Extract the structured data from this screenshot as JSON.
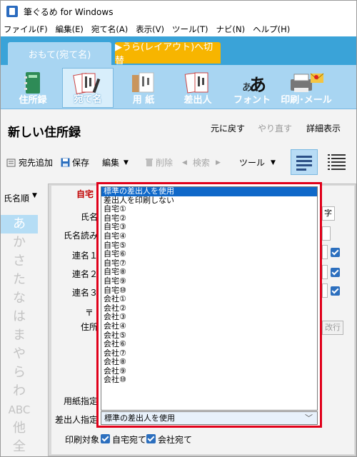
{
  "window": {
    "title": "筆ぐるめ for Windows"
  },
  "menu": [
    "ファイル(F)",
    "編集(E)",
    "宛て名(A)",
    "表示(V)",
    "ツール(T)",
    "ナビ(N)",
    "ヘルプ(H)"
  ],
  "tabs": {
    "front": "おもて(宛て名)",
    "back": "▶うら(レイアウト)へ切替"
  },
  "ribbon": [
    {
      "label": "住所録",
      "icon": "address-book-icon"
    },
    {
      "label": "宛て名",
      "icon": "postcards-icon",
      "selected": true
    },
    {
      "label": "用 紙",
      "icon": "envelope-paper-icon"
    },
    {
      "label": "差出人",
      "icon": "sender-postcard-icon"
    },
    {
      "label": "フォント",
      "icon": "font-icon"
    },
    {
      "label": "印刷･メール",
      "icon": "printer-mail-icon"
    }
  ],
  "header": {
    "title": "新しい住所録",
    "undo": "元に戻す",
    "redo": "やり直す",
    "detail": "詳細表示"
  },
  "toolbar": {
    "add": "宛先追加",
    "save": "保存",
    "edit": "編集",
    "delete": "削除",
    "search": "検索",
    "tool": "ツール"
  },
  "sidebar": {
    "sort_label": "氏名順",
    "kana": [
      "あ",
      "か",
      "さ",
      "た",
      "な",
      "は",
      "ま",
      "や",
      "ら",
      "わ",
      "ABC",
      "他",
      "全"
    ]
  },
  "form": {
    "home_label": "自宅",
    "name_label": "氏名",
    "reading_label": "氏名読み",
    "co1_label": "連名１",
    "co2_label": "連名２",
    "co3_label": "連名３",
    "postal_label": "〒",
    "address_label": "住所",
    "paper_label": "用紙指定",
    "sender_label": "差出人指定",
    "print_target_label": "印刷対象",
    "print_home": "自宅宛て",
    "print_company": "会社宛て",
    "right_char": "字",
    "newline_btn": "改行"
  },
  "dropdown": {
    "selected_value": "標準の差出人を使用",
    "options": [
      "標準の差出人を使用",
      "差出人を印刷しない",
      "自宅①",
      "自宅②",
      "自宅③",
      "自宅④",
      "自宅⑤",
      "自宅⑥",
      "自宅⑦",
      "自宅⑧",
      "自宅⑨",
      "自宅⑩",
      "会社①",
      "会社②",
      "会社③",
      "会社④",
      "会社⑤",
      "会社⑥",
      "会社⑦",
      "会社⑧",
      "会社⑨",
      "会社⑩"
    ],
    "highlight_color": "#e0001a"
  }
}
